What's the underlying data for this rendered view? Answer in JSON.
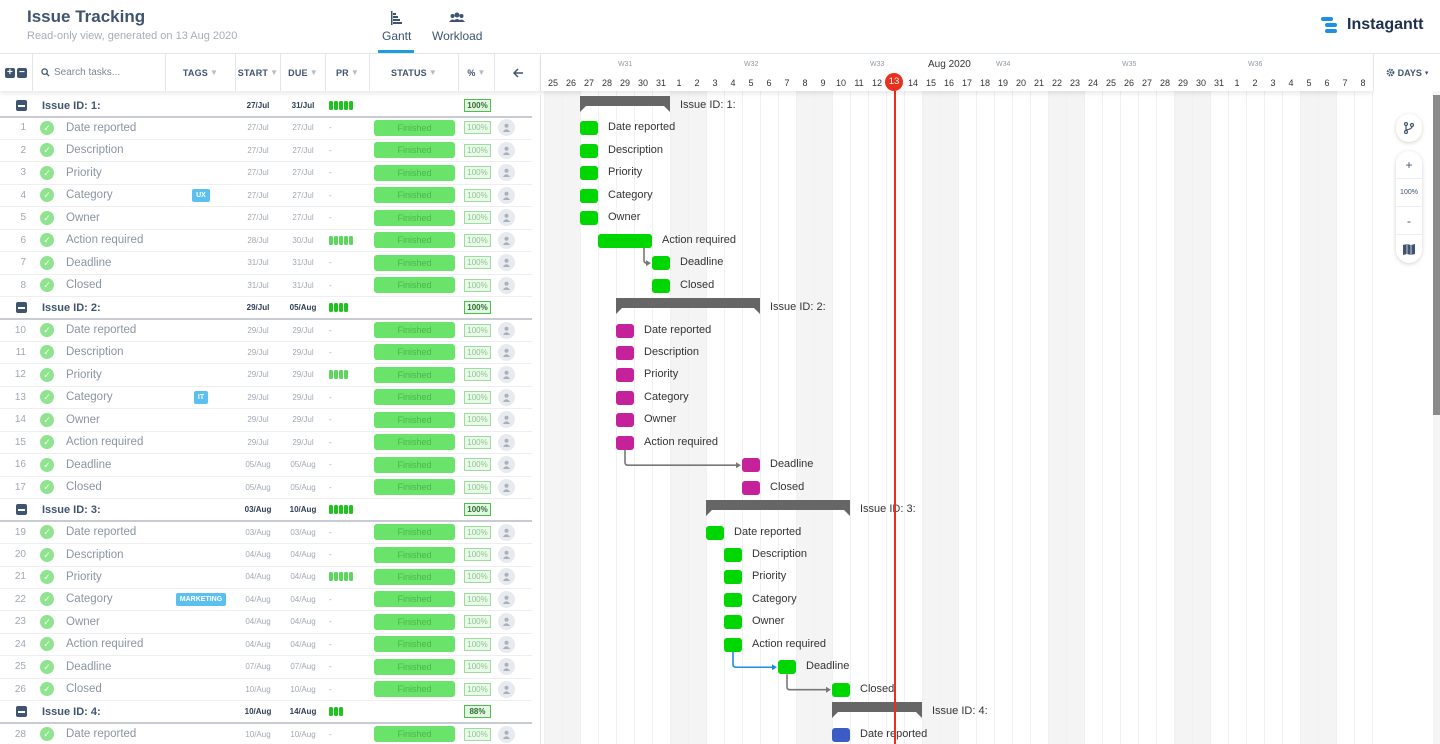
{
  "header": {
    "title": "Issue Tracking",
    "subtitle": "Read-only view, generated on 13 Aug 2020",
    "tabs": [
      {
        "label": "Gantt",
        "icon": "gantt-icon",
        "active": true
      },
      {
        "label": "Workload",
        "icon": "users-icon",
        "active": false
      }
    ],
    "brand": "Instagantt"
  },
  "grid": {
    "search_placeholder": "Search tasks...",
    "columns": {
      "tags": "TAGS",
      "start": "START",
      "due": "DUE",
      "pr": "PR",
      "status": "STATUS",
      "pct": "%"
    },
    "rows": [
      {
        "type": "parent",
        "name": "Issue ID: 1:",
        "start": "27/Jul",
        "due": "31/Jul",
        "pr": 5,
        "pct": "100%"
      },
      {
        "type": "task",
        "num": "1",
        "name": "Date reported",
        "tag": "",
        "start": "27/Jul",
        "due": "27/Jul",
        "pr": 0,
        "status": "Finished",
        "pct": "100%"
      },
      {
        "type": "task",
        "num": "2",
        "name": "Description",
        "tag": "",
        "start": "27/Jul",
        "due": "27/Jul",
        "pr": 0,
        "status": "Finished",
        "pct": "100%"
      },
      {
        "type": "task",
        "num": "3",
        "name": "Priority",
        "tag": "",
        "start": "27/Jul",
        "due": "27/Jul",
        "pr": 0,
        "status": "Finished",
        "pct": "100%"
      },
      {
        "type": "task",
        "num": "4",
        "name": "Category",
        "tag": "UX",
        "start": "27/Jul",
        "due": "27/Jul",
        "pr": 0,
        "status": "Finished",
        "pct": "100%"
      },
      {
        "type": "task",
        "num": "5",
        "name": "Owner",
        "tag": "",
        "start": "27/Jul",
        "due": "27/Jul",
        "pr": 0,
        "status": "Finished",
        "pct": "100%"
      },
      {
        "type": "task",
        "num": "6",
        "name": "Action required",
        "tag": "",
        "start": "28/Jul",
        "due": "30/Jul",
        "pr": 5,
        "status": "Finished",
        "pct": "100%"
      },
      {
        "type": "task",
        "num": "7",
        "name": "Deadline",
        "tag": "",
        "start": "31/Jul",
        "due": "31/Jul",
        "pr": 0,
        "status": "Finished",
        "pct": "100%"
      },
      {
        "type": "task",
        "num": "8",
        "name": "Closed",
        "tag": "",
        "start": "31/Jul",
        "due": "31/Jul",
        "pr": 0,
        "status": "Finished",
        "pct": "100%"
      },
      {
        "type": "parent",
        "name": "Issue ID: 2:",
        "start": "29/Jul",
        "due": "05/Aug",
        "pr": 4,
        "pct": "100%"
      },
      {
        "type": "task",
        "num": "10",
        "name": "Date reported",
        "tag": "",
        "start": "29/Jul",
        "due": "29/Jul",
        "pr": 0,
        "status": "Finished",
        "pct": "100%"
      },
      {
        "type": "task",
        "num": "11",
        "name": "Description",
        "tag": "",
        "start": "29/Jul",
        "due": "29/Jul",
        "pr": 0,
        "status": "Finished",
        "pct": "100%"
      },
      {
        "type": "task",
        "num": "12",
        "name": "Priority",
        "tag": "",
        "start": "29/Jul",
        "due": "29/Jul",
        "pr": 4,
        "status": "Finished",
        "pct": "100%"
      },
      {
        "type": "task",
        "num": "13",
        "name": "Category",
        "tag": "IT",
        "start": "29/Jul",
        "due": "29/Jul",
        "pr": 0,
        "status": "Finished",
        "pct": "100%"
      },
      {
        "type": "task",
        "num": "14",
        "name": "Owner",
        "tag": "",
        "start": "29/Jul",
        "due": "29/Jul",
        "pr": 0,
        "status": "Finished",
        "pct": "100%"
      },
      {
        "type": "task",
        "num": "15",
        "name": "Action required",
        "tag": "",
        "start": "29/Jul",
        "due": "29/Jul",
        "pr": 0,
        "status": "Finished",
        "pct": "100%"
      },
      {
        "type": "task",
        "num": "16",
        "name": "Deadline",
        "tag": "",
        "start": "05/Aug",
        "due": "05/Aug",
        "pr": 0,
        "status": "Finished",
        "pct": "100%"
      },
      {
        "type": "task",
        "num": "17",
        "name": "Closed",
        "tag": "",
        "start": "05/Aug",
        "due": "05/Aug",
        "pr": 0,
        "status": "Finished",
        "pct": "100%"
      },
      {
        "type": "parent",
        "name": "Issue ID: 3:",
        "start": "03/Aug",
        "due": "10/Aug",
        "pr": 5,
        "pct": "100%"
      },
      {
        "type": "task",
        "num": "19",
        "name": "Date reported",
        "tag": "",
        "start": "03/Aug",
        "due": "03/Aug",
        "pr": 0,
        "status": "Finished",
        "pct": "100%"
      },
      {
        "type": "task",
        "num": "20",
        "name": "Description",
        "tag": "",
        "start": "04/Aug",
        "due": "04/Aug",
        "pr": 0,
        "status": "Finished",
        "pct": "100%"
      },
      {
        "type": "task",
        "num": "21",
        "name": "Priority",
        "tag": "",
        "start": "04/Aug",
        "due": "04/Aug",
        "pr": 5,
        "status": "Finished",
        "pct": "100%"
      },
      {
        "type": "task",
        "num": "22",
        "name": "Category",
        "tag": "MARKETING",
        "start": "04/Aug",
        "due": "04/Aug",
        "pr": 0,
        "status": "Finished",
        "pct": "100%"
      },
      {
        "type": "task",
        "num": "23",
        "name": "Owner",
        "tag": "",
        "start": "04/Aug",
        "due": "04/Aug",
        "pr": 0,
        "status": "Finished",
        "pct": "100%"
      },
      {
        "type": "task",
        "num": "24",
        "name": "Action required",
        "tag": "",
        "start": "04/Aug",
        "due": "04/Aug",
        "pr": 0,
        "status": "Finished",
        "pct": "100%"
      },
      {
        "type": "task",
        "num": "25",
        "name": "Deadline",
        "tag": "",
        "start": "07/Aug",
        "due": "07/Aug",
        "pr": 0,
        "status": "Finished",
        "pct": "100%"
      },
      {
        "type": "task",
        "num": "26",
        "name": "Closed",
        "tag": "",
        "start": "10/Aug",
        "due": "10/Aug",
        "pr": 0,
        "status": "Finished",
        "pct": "100%"
      },
      {
        "type": "parent",
        "name": "Issue ID: 4:",
        "start": "10/Aug",
        "due": "14/Aug",
        "pr": 3,
        "pct": "88%"
      },
      {
        "type": "task",
        "num": "28",
        "name": "Date reported",
        "tag": "",
        "start": "10/Aug",
        "due": "10/Aug",
        "pr": 0,
        "status": "Finished",
        "pct": "100%"
      }
    ]
  },
  "timeline": {
    "month_label": "Aug 2020",
    "weeks": [
      {
        "label": "W31",
        "day_index": 4
      },
      {
        "label": "W32",
        "day_index": 11
      },
      {
        "label": "W33",
        "day_index": 18
      },
      {
        "label": "W34",
        "day_index": 25
      },
      {
        "label": "W35",
        "day_index": 32
      },
      {
        "label": "W36",
        "day_index": 39
      }
    ],
    "days": [
      "25",
      "26",
      "27",
      "28",
      "29",
      "30",
      "31",
      "1",
      "2",
      "3",
      "4",
      "5",
      "6",
      "7",
      "8",
      "9",
      "10",
      "11",
      "12",
      "13",
      "14",
      "15",
      "16",
      "17",
      "18",
      "19",
      "20",
      "21",
      "22",
      "23",
      "24",
      "25",
      "26",
      "27",
      "28",
      "29",
      "30",
      "31",
      "1",
      "2",
      "3",
      "4",
      "5",
      "6",
      "7",
      "8"
    ],
    "weekend_start_indices": [
      0,
      7,
      14,
      21,
      28,
      35,
      42
    ],
    "today_index": 19,
    "today_label": "13",
    "scale_button": "DAYS",
    "zoom_level": "100%"
  },
  "gantt_bars": [
    {
      "row": 0,
      "type": "summary",
      "start": 2,
      "days": 5,
      "label": "Issue ID: 1:"
    },
    {
      "row": 1,
      "type": "task",
      "start": 2,
      "days": 1,
      "color": "#00d600",
      "label": "Date reported"
    },
    {
      "row": 2,
      "type": "task",
      "start": 2,
      "days": 1,
      "color": "#00d600",
      "label": "Description"
    },
    {
      "row": 3,
      "type": "task",
      "start": 2,
      "days": 1,
      "color": "#00d600",
      "label": "Priority"
    },
    {
      "row": 4,
      "type": "task",
      "start": 2,
      "days": 1,
      "color": "#00d600",
      "label": "Category"
    },
    {
      "row": 5,
      "type": "task",
      "start": 2,
      "days": 1,
      "color": "#00d600",
      "label": "Owner"
    },
    {
      "row": 6,
      "type": "task",
      "start": 3,
      "days": 3,
      "color": "#00d600",
      "label": "Action required"
    },
    {
      "row": 7,
      "type": "task",
      "start": 6,
      "days": 1,
      "color": "#00d600",
      "label": "Deadline"
    },
    {
      "row": 8,
      "type": "task",
      "start": 6,
      "days": 1,
      "color": "#00d600",
      "label": "Closed"
    },
    {
      "row": 9,
      "type": "summary",
      "start": 4,
      "days": 8,
      "label": "Issue ID: 2:"
    },
    {
      "row": 10,
      "type": "task",
      "start": 4,
      "days": 1,
      "color": "#c4219a",
      "label": "Date reported"
    },
    {
      "row": 11,
      "type": "task",
      "start": 4,
      "days": 1,
      "color": "#c4219a",
      "label": "Description"
    },
    {
      "row": 12,
      "type": "task",
      "start": 4,
      "days": 1,
      "color": "#c4219a",
      "label": "Priority"
    },
    {
      "row": 13,
      "type": "task",
      "start": 4,
      "days": 1,
      "color": "#c4219a",
      "label": "Category"
    },
    {
      "row": 14,
      "type": "task",
      "start": 4,
      "days": 1,
      "color": "#c4219a",
      "label": "Owner"
    },
    {
      "row": 15,
      "type": "task",
      "start": 4,
      "days": 1,
      "color": "#c4219a",
      "label": "Action required"
    },
    {
      "row": 16,
      "type": "task",
      "start": 11,
      "days": 1,
      "color": "#c4219a",
      "label": "Deadline"
    },
    {
      "row": 17,
      "type": "task",
      "start": 11,
      "days": 1,
      "color": "#c4219a",
      "label": "Closed"
    },
    {
      "row": 18,
      "type": "summary",
      "start": 9,
      "days": 8,
      "label": "Issue ID: 3:"
    },
    {
      "row": 19,
      "type": "task",
      "start": 9,
      "days": 1,
      "color": "#00d600",
      "label": "Date reported"
    },
    {
      "row": 20,
      "type": "task",
      "start": 10,
      "days": 1,
      "color": "#00d600",
      "label": "Description"
    },
    {
      "row": 21,
      "type": "task",
      "start": 10,
      "days": 1,
      "color": "#00d600",
      "label": "Priority"
    },
    {
      "row": 22,
      "type": "task",
      "start": 10,
      "days": 1,
      "color": "#00d600",
      "label": "Category"
    },
    {
      "row": 23,
      "type": "task",
      "start": 10,
      "days": 1,
      "color": "#00d600",
      "label": "Owner"
    },
    {
      "row": 24,
      "type": "task",
      "start": 10,
      "days": 1,
      "color": "#00d600",
      "label": "Action required"
    },
    {
      "row": 25,
      "type": "task",
      "start": 13,
      "days": 1,
      "color": "#00d600",
      "label": "Deadline"
    },
    {
      "row": 26,
      "type": "task",
      "start": 16,
      "days": 1,
      "color": "#00d600",
      "label": "Closed"
    },
    {
      "row": 27,
      "type": "summary",
      "start": 16,
      "days": 5,
      "label": "Issue ID: 4:"
    },
    {
      "row": 28,
      "type": "task",
      "start": 16,
      "days": 1,
      "color": "#3b5cc4",
      "label": "Date reported"
    }
  ],
  "dependencies": [
    {
      "from": 6,
      "to": 7,
      "color": "#777777"
    },
    {
      "from": 15,
      "to": 16,
      "color": "#777777"
    },
    {
      "from": 24,
      "to": 25,
      "color": "#1c8fdc"
    },
    {
      "from": 25,
      "to": 26,
      "color": "#777777"
    }
  ],
  "colors": {
    "accent": "#1c9de0",
    "today": "#e8301c",
    "finished": "#69e369"
  }
}
